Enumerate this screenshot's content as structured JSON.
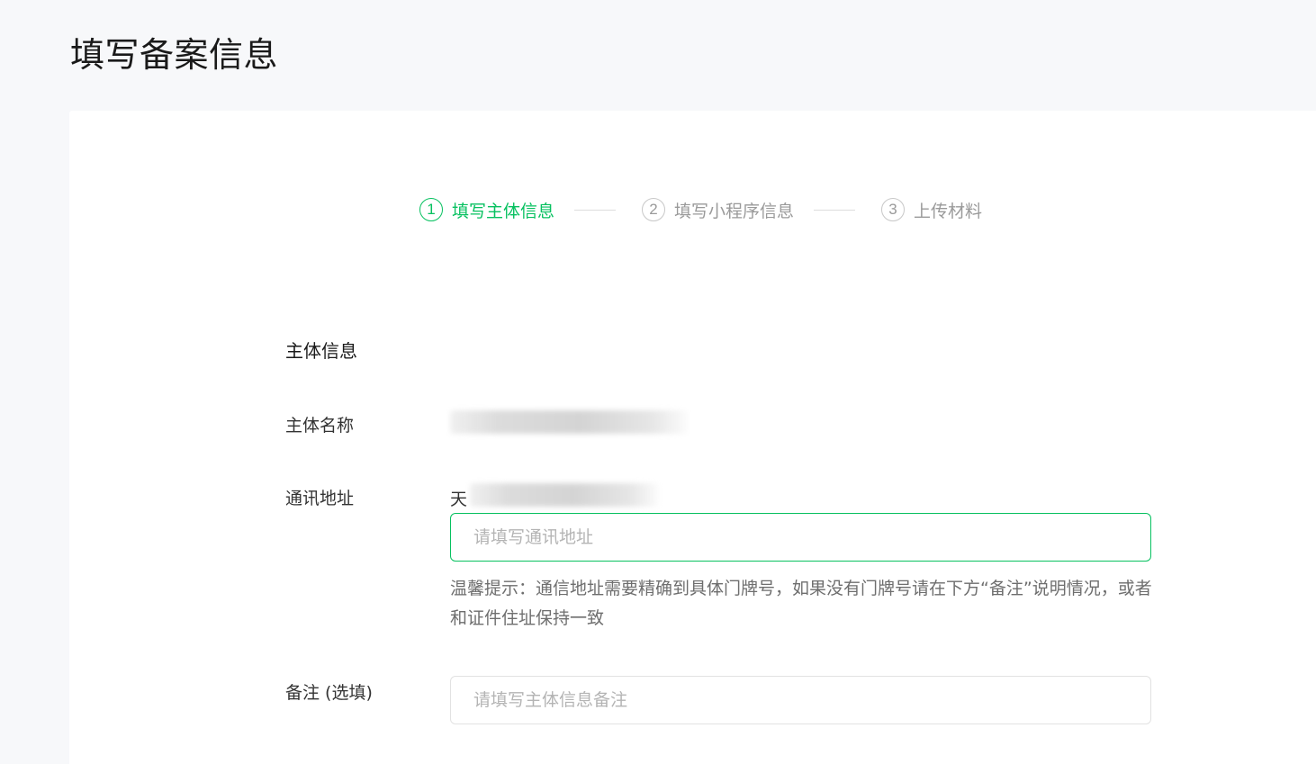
{
  "page": {
    "title": "填写备案信息"
  },
  "steps": [
    {
      "number": "1",
      "label": "填写主体信息",
      "active": true
    },
    {
      "number": "2",
      "label": "填写小程序信息",
      "active": false
    },
    {
      "number": "3",
      "label": "上传材料",
      "active": false
    }
  ],
  "form": {
    "section_title": "主体信息",
    "subject_name": {
      "label": "主体名称"
    },
    "address": {
      "label": "通讯地址",
      "prefix": "天",
      "placeholder": "请填写通讯地址",
      "hint": "温馨提示：通信地址需要精确到具体门牌号，如果没有门牌号请在下方“备注”说明情况，或者和证件住址保持一致"
    },
    "remark": {
      "label": "备注 (选填)",
      "placeholder": "请填写主体信息备注"
    }
  },
  "colors": {
    "accent": "#07c160",
    "background": "#f7f8fa",
    "muted": "#9a9a9a"
  }
}
